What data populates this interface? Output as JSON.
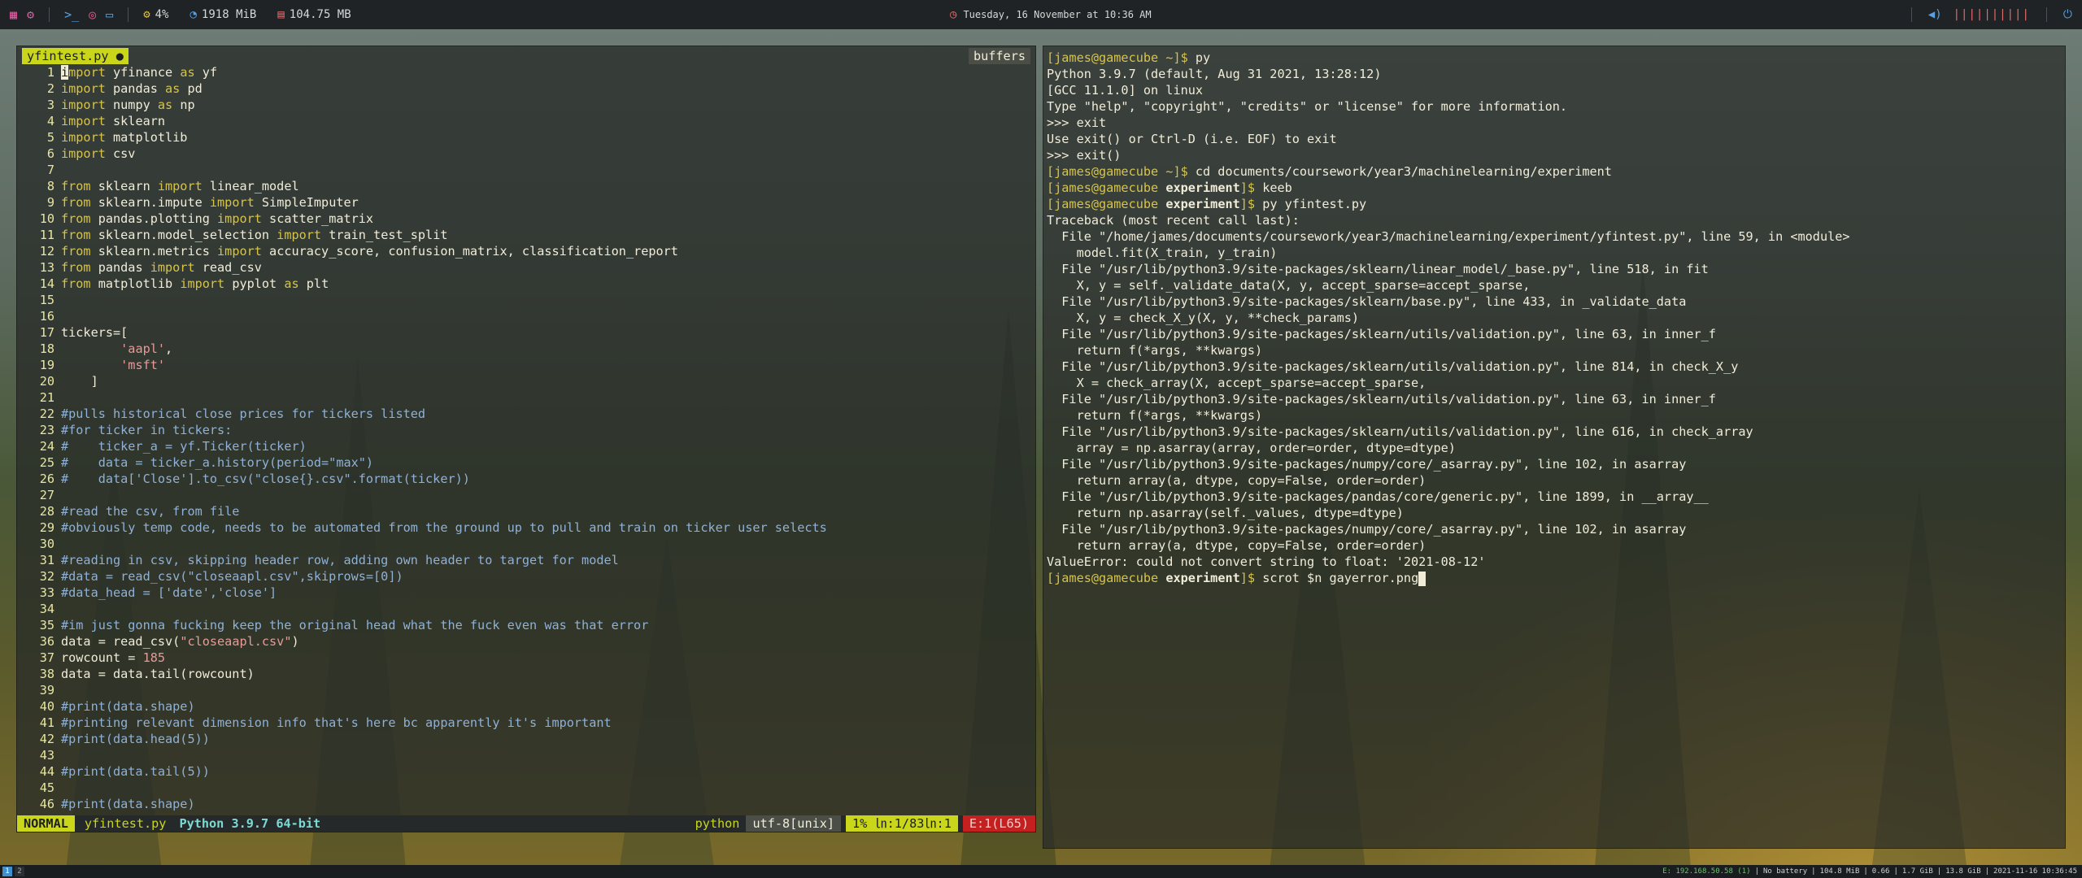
{
  "topbar": {
    "cpu": "4%",
    "mem": "1918 MiB",
    "disk": "104.75 MB",
    "datetime": "Tuesday, 16 November at 10:36 AM",
    "volume_bars": "||||||||||"
  },
  "vim": {
    "tab_label": "yfintest.py ●",
    "buffers_label": "buffers",
    "lines": [
      {
        "n": "1",
        "segs": [
          [
            "cur",
            "i"
          ],
          [
            "kw",
            "mport"
          ],
          [
            "t",
            " yfinance "
          ],
          [
            "kw",
            "as"
          ],
          [
            "t",
            " yf"
          ]
        ]
      },
      {
        "n": "2",
        "segs": [
          [
            "kw",
            "import"
          ],
          [
            "t",
            " pandas "
          ],
          [
            "kw",
            "as"
          ],
          [
            "t",
            " pd"
          ]
        ]
      },
      {
        "n": "3",
        "segs": [
          [
            "kw",
            "import"
          ],
          [
            "t",
            " numpy "
          ],
          [
            "kw",
            "as"
          ],
          [
            "t",
            " np"
          ]
        ]
      },
      {
        "n": "4",
        "segs": [
          [
            "kw",
            "import"
          ],
          [
            "t",
            " sklearn"
          ]
        ]
      },
      {
        "n": "5",
        "segs": [
          [
            "kw",
            "import"
          ],
          [
            "t",
            " matplotlib"
          ]
        ]
      },
      {
        "n": "6",
        "segs": [
          [
            "kw",
            "import"
          ],
          [
            "t",
            " csv"
          ]
        ]
      },
      {
        "n": "7",
        "segs": []
      },
      {
        "n": "8",
        "segs": [
          [
            "kw",
            "from"
          ],
          [
            "t",
            " sklearn "
          ],
          [
            "kw",
            "import"
          ],
          [
            "t",
            " linear_model"
          ]
        ]
      },
      {
        "n": "9",
        "segs": [
          [
            "kw",
            "from"
          ],
          [
            "t",
            " sklearn.impute "
          ],
          [
            "kw",
            "import"
          ],
          [
            "t",
            " SimpleImputer"
          ]
        ]
      },
      {
        "n": "10",
        "segs": [
          [
            "kw",
            "from"
          ],
          [
            "t",
            " pandas.plotting "
          ],
          [
            "kw",
            "import"
          ],
          [
            "t",
            " scatter_matrix"
          ]
        ]
      },
      {
        "n": "11",
        "segs": [
          [
            "kw",
            "from"
          ],
          [
            "t",
            " sklearn.model_selection "
          ],
          [
            "kw",
            "import"
          ],
          [
            "t",
            " train_test_split"
          ]
        ]
      },
      {
        "n": "12",
        "segs": [
          [
            "kw",
            "from"
          ],
          [
            "t",
            " sklearn.metrics "
          ],
          [
            "kw",
            "import"
          ],
          [
            "t",
            " accuracy_score, confusion_matrix, classification_report"
          ]
        ]
      },
      {
        "n": "13",
        "segs": [
          [
            "kw",
            "from"
          ],
          [
            "t",
            " pandas "
          ],
          [
            "kw",
            "import"
          ],
          [
            "t",
            " read_csv"
          ]
        ]
      },
      {
        "n": "14",
        "segs": [
          [
            "kw",
            "from"
          ],
          [
            "t",
            " matplotlib "
          ],
          [
            "kw",
            "import"
          ],
          [
            "t",
            " pyplot "
          ],
          [
            "kw",
            "as"
          ],
          [
            "t",
            " plt"
          ]
        ]
      },
      {
        "n": "15",
        "segs": []
      },
      {
        "n": "16",
        "segs": []
      },
      {
        "n": "17",
        "segs": [
          [
            "t",
            "tickers=["
          ]
        ]
      },
      {
        "n": "18",
        "segs": [
          [
            "t",
            "        "
          ],
          [
            "str",
            "'aapl'"
          ],
          [
            "t",
            ","
          ]
        ]
      },
      {
        "n": "19",
        "segs": [
          [
            "t",
            "        "
          ],
          [
            "str",
            "'msft'"
          ]
        ]
      },
      {
        "n": "20",
        "segs": [
          [
            "t",
            "    ]"
          ]
        ]
      },
      {
        "n": "21",
        "segs": []
      },
      {
        "n": "22",
        "segs": [
          [
            "com",
            "#pulls historical close prices for tickers listed"
          ]
        ]
      },
      {
        "n": "23",
        "segs": [
          [
            "com",
            "#for ticker in tickers:"
          ]
        ]
      },
      {
        "n": "24",
        "segs": [
          [
            "com",
            "#    ticker_a = yf.Ticker(ticker)"
          ]
        ]
      },
      {
        "n": "25",
        "segs": [
          [
            "com",
            "#    data = ticker_a.history(period=\"max\")"
          ]
        ]
      },
      {
        "n": "26",
        "segs": [
          [
            "com",
            "#    data['Close'].to_csv(\"close{}.csv\".format(ticker))"
          ]
        ]
      },
      {
        "n": "27",
        "segs": []
      },
      {
        "n": "28",
        "segs": [
          [
            "com",
            "#read the csv, from file"
          ]
        ]
      },
      {
        "n": "29",
        "segs": [
          [
            "com",
            "#obviously temp code, needs to be automated from the ground up to pull and train on ticker user selects"
          ]
        ]
      },
      {
        "n": "30",
        "segs": []
      },
      {
        "n": "31",
        "segs": [
          [
            "com",
            "#reading in csv, skipping header row, adding own header to target for model"
          ]
        ]
      },
      {
        "n": "32",
        "segs": [
          [
            "com",
            "#data = read_csv(\"closeaapl.csv\",skiprows=[0])"
          ]
        ]
      },
      {
        "n": "33",
        "segs": [
          [
            "com",
            "#data_head = ['date','close']"
          ]
        ]
      },
      {
        "n": "34",
        "segs": []
      },
      {
        "n": "35",
        "segs": [
          [
            "com",
            "#im just gonna fucking keep the original head what the fuck even was that error"
          ]
        ]
      },
      {
        "n": "36",
        "segs": [
          [
            "t",
            "data = read_csv("
          ],
          [
            "str",
            "\"closeaapl.csv\""
          ],
          [
            "t",
            ")"
          ]
        ]
      },
      {
        "n": "37",
        "segs": [
          [
            "t",
            "rowcount = "
          ],
          [
            "num",
            "185"
          ]
        ]
      },
      {
        "n": "38",
        "segs": [
          [
            "t",
            "data = data.tail(rowcount)"
          ]
        ]
      },
      {
        "n": "39",
        "segs": []
      },
      {
        "n": "40",
        "segs": [
          [
            "com",
            "#print(data.shape)"
          ]
        ]
      },
      {
        "n": "41",
        "segs": [
          [
            "com",
            "#printing relevant dimension info that's here bc apparently it's important"
          ]
        ]
      },
      {
        "n": "42",
        "segs": [
          [
            "com",
            "#print(data.head(5))"
          ]
        ]
      },
      {
        "n": "43",
        "segs": []
      },
      {
        "n": "44",
        "segs": [
          [
            "com",
            "#print(data.tail(5))"
          ]
        ]
      },
      {
        "n": "45",
        "segs": []
      },
      {
        "n": "46",
        "segs": [
          [
            "com",
            "#print(data.shape)"
          ]
        ]
      }
    ],
    "status": {
      "mode": "NORMAL",
      "file": "yfintest.py",
      "python": "Python 3.9.7 64-bit",
      "filetype": "python",
      "encoding": "utf-8[unix]",
      "position": "1% ㏑:1/83㏑:1",
      "errors": "E:1(L65)"
    }
  },
  "terminal": {
    "lines": [
      [
        [
          "user",
          "[james@gamecube ~]$"
        ],
        [
          "t",
          " py"
        ]
      ],
      [
        [
          "t",
          "Python 3.9.7 (default, Aug 31 2021, 13:28:12)"
        ]
      ],
      [
        [
          "t",
          "[GCC 11.1.0] on linux"
        ]
      ],
      [
        [
          "t",
          "Type \"help\", \"copyright\", \"credits\" or \"license\" for more information."
        ]
      ],
      [
        [
          "t",
          ">>> exit"
        ]
      ],
      [
        [
          "t",
          "Use exit() or Ctrl-D (i.e. EOF) to exit"
        ]
      ],
      [
        [
          "t",
          ">>> exit()"
        ]
      ],
      [
        [
          "user",
          "[james@gamecube ~]$"
        ],
        [
          "t",
          " cd documents/coursework/year3/machinelearning/experiment"
        ]
      ],
      [
        [
          "user",
          "[james@gamecube "
        ],
        [
          "dir",
          "experiment"
        ],
        [
          "user",
          "]$"
        ],
        [
          "t",
          " keeb"
        ]
      ],
      [
        [
          "user",
          "[james@gamecube "
        ],
        [
          "dir",
          "experiment"
        ],
        [
          "user",
          "]$"
        ],
        [
          "t",
          " py yfintest.py"
        ]
      ],
      [
        [
          "t",
          "Traceback (most recent call last):"
        ]
      ],
      [
        [
          "t",
          "  File \"/home/james/documents/coursework/year3/machinelearning/experiment/yfintest.py\", line 59, in <module>"
        ]
      ],
      [
        [
          "t",
          "    model.fit(X_train, y_train)"
        ]
      ],
      [
        [
          "t",
          "  File \"/usr/lib/python3.9/site-packages/sklearn/linear_model/_base.py\", line 518, in fit"
        ]
      ],
      [
        [
          "t",
          "    X, y = self._validate_data(X, y, accept_sparse=accept_sparse,"
        ]
      ],
      [
        [
          "t",
          "  File \"/usr/lib/python3.9/site-packages/sklearn/base.py\", line 433, in _validate_data"
        ]
      ],
      [
        [
          "t",
          "    X, y = check_X_y(X, y, **check_params)"
        ]
      ],
      [
        [
          "t",
          "  File \"/usr/lib/python3.9/site-packages/sklearn/utils/validation.py\", line 63, in inner_f"
        ]
      ],
      [
        [
          "t",
          "    return f(*args, **kwargs)"
        ]
      ],
      [
        [
          "t",
          "  File \"/usr/lib/python3.9/site-packages/sklearn/utils/validation.py\", line 814, in check_X_y"
        ]
      ],
      [
        [
          "t",
          "    X = check_array(X, accept_sparse=accept_sparse,"
        ]
      ],
      [
        [
          "t",
          "  File \"/usr/lib/python3.9/site-packages/sklearn/utils/validation.py\", line 63, in inner_f"
        ]
      ],
      [
        [
          "t",
          "    return f(*args, **kwargs)"
        ]
      ],
      [
        [
          "t",
          "  File \"/usr/lib/python3.9/site-packages/sklearn/utils/validation.py\", line 616, in check_array"
        ]
      ],
      [
        [
          "t",
          "    array = np.asarray(array, order=order, dtype=dtype)"
        ]
      ],
      [
        [
          "t",
          "  File \"/usr/lib/python3.9/site-packages/numpy/core/_asarray.py\", line 102, in asarray"
        ]
      ],
      [
        [
          "t",
          "    return array(a, dtype, copy=False, order=order)"
        ]
      ],
      [
        [
          "t",
          "  File \"/usr/lib/python3.9/site-packages/pandas/core/generic.py\", line 1899, in __array__"
        ]
      ],
      [
        [
          "t",
          "    return np.asarray(self._values, dtype=dtype)"
        ]
      ],
      [
        [
          "t",
          "  File \"/usr/lib/python3.9/site-packages/numpy/core/_asarray.py\", line 102, in asarray"
        ]
      ],
      [
        [
          "t",
          "    return array(a, dtype, copy=False, order=order)"
        ]
      ],
      [
        [
          "t",
          "ValueError: could not convert string to float: '2021-08-12'"
        ]
      ],
      [
        [
          "user",
          "[james@gamecube "
        ],
        [
          "dir",
          "experiment"
        ],
        [
          "user",
          "]$"
        ],
        [
          "t",
          " scrot $n gayerror.png"
        ],
        [
          "cursor",
          ""
        ]
      ]
    ]
  },
  "bottombar": {
    "ws1": "1",
    "ws2": "2",
    "ip": "E: 192.168.50.58 (1)",
    "battery": "No battery",
    "mem": "104.8 MiB",
    "load": "0.66",
    "ram": "1.7 GiB",
    "swap": "13.8 GiB",
    "clock": "2021-11-16 10:36:45"
  }
}
